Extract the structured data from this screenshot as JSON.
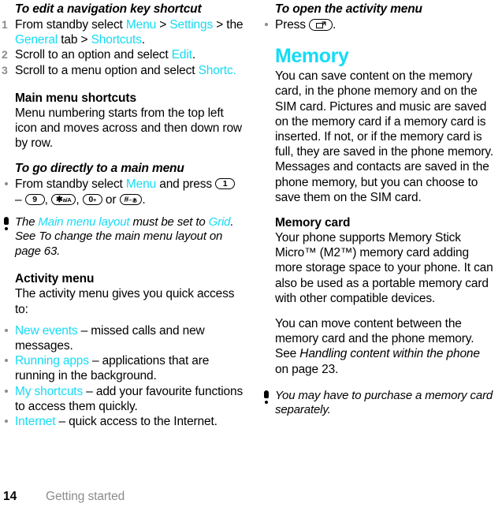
{
  "left": {
    "procedure_heading": "To edit a navigation key shortcut",
    "steps": [
      {
        "num": "1",
        "parts": [
          {
            "t": "From standby select ",
            "c": "k"
          },
          {
            "t": "Menu",
            "c": "ui"
          },
          {
            "t": " > ",
            "c": "k"
          },
          {
            "t": "Settings",
            "c": "ui"
          },
          {
            "t": " > the ",
            "c": "k"
          },
          {
            "t": "General",
            "c": "ui"
          },
          {
            "t": " tab > ",
            "c": "k"
          },
          {
            "t": "Shortcuts",
            "c": "ui"
          },
          {
            "t": ".",
            "c": "k"
          }
        ]
      },
      {
        "num": "2",
        "parts": [
          {
            "t": "Scroll to an option and select ",
            "c": "k"
          },
          {
            "t": "Edit",
            "c": "ui"
          },
          {
            "t": ".",
            "c": "k"
          }
        ]
      },
      {
        "num": "3",
        "parts": [
          {
            "t": "Scroll to a menu option and select ",
            "c": "k"
          },
          {
            "t": "Shortc.",
            "c": "ui"
          }
        ]
      }
    ],
    "main_menu_shortcuts_heading": "Main menu shortcuts",
    "main_menu_shortcuts_body": "Menu numbering starts from the top left icon and moves across and then down row by row.",
    "go_directly_heading": "To go directly to a main menu",
    "go_directly_bullet": {
      "pre": "From standby select ",
      "ui": "Menu",
      "mid": " and press ",
      "keys": [
        {
          "label": "1",
          "sup": ""
        },
        {
          "sep": " – "
        },
        {
          "label": "9",
          "sup": ""
        },
        {
          "sep": ", "
        },
        {
          "label": "✱",
          "sup": "a/A"
        },
        {
          "sep": ", "
        },
        {
          "label": "0",
          "sup": "+"
        },
        {
          "sep": " or "
        },
        {
          "label": "#",
          "sup": "–ぁ"
        }
      ],
      "post": "."
    },
    "note": {
      "pre": "The ",
      "ui1": "Main menu layout",
      "mid1": " must be set to ",
      "ui2": "Grid",
      "post": ". See To change the main menu layout on page 63."
    },
    "activity_menu_heading": "Activity menu",
    "activity_menu_body": "The activity menu gives you quick access to:",
    "activity_items": [
      {
        "ui": "New events",
        "rest": " – missed calls and new messages."
      },
      {
        "ui": "Running apps",
        "rest": " – applications that are running in the background."
      },
      {
        "ui": "My shortcuts",
        "rest": " – add your favourite functions to access them quickly."
      },
      {
        "ui": "Internet",
        "rest": " – quick access to the Internet."
      }
    ]
  },
  "right": {
    "procedure_heading": "To open the activity menu",
    "press_label": "Press ",
    "press_suffix": ".",
    "memory_heading": "Memory",
    "memory_body": "You can save content on the memory card, in the phone memory and on the SIM card. Pictures and music are saved on the memory card if a memory card is inserted. If not, or if the memory card is full, they are saved in the phone memory. Messages and contacts are saved in the phone memory, but you can choose to save them on the SIM card.",
    "memory_card_heading": "Memory card",
    "memory_card_body": "Your phone supports Memory Stick Micro™ (M2™) memory card adding more storage space to your phone. It can also be used as a portable memory card with other compatible devices.",
    "move_content": {
      "pre": "You can move content between the memory card and the phone memory. See ",
      "ital": "Handling content within the phone",
      "post": " on page 23."
    },
    "note": "You may have to purchase a memory card separately."
  },
  "footer": {
    "page_number": "14",
    "section": "Getting started"
  },
  "colors": {
    "ui_cyan": "#15dbf5",
    "muted_gray": "#8c8c8c",
    "text_black": "#000000"
  }
}
